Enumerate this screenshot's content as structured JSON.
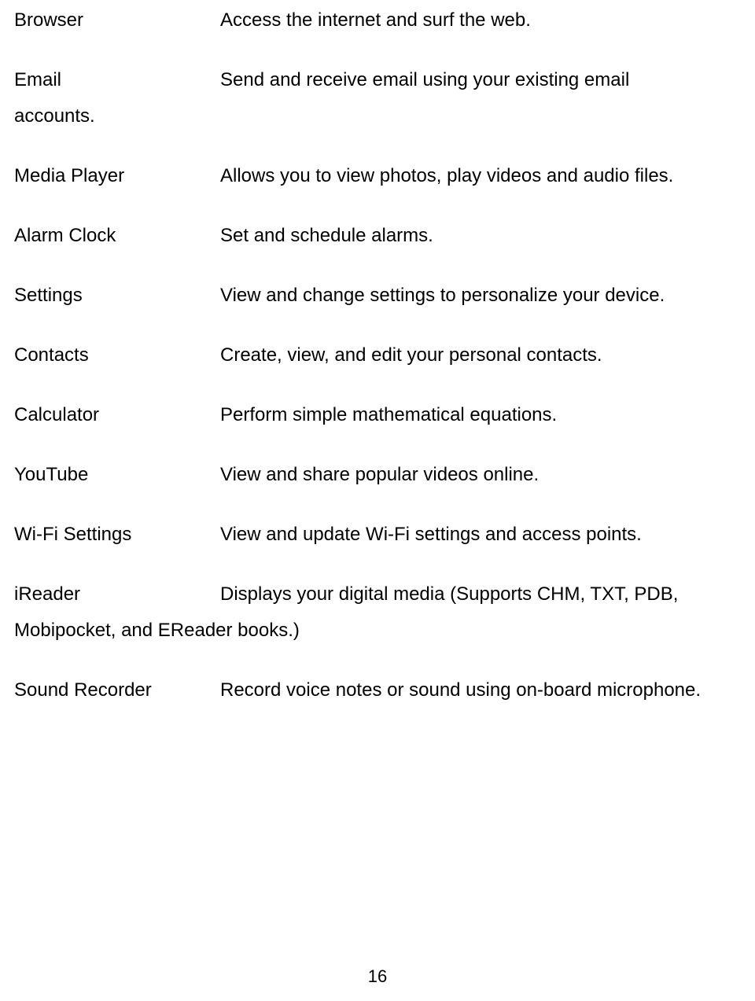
{
  "items": {
    "browser": {
      "label": "Browser",
      "desc": "Access the internet and surf the web."
    },
    "email": {
      "label": "Email",
      "desc": "Send and receive email using your existing email",
      "continued": "accounts."
    },
    "mediaPlayer": {
      "label": "Media Player",
      "desc": "Allows you to view photos, play videos and audio files."
    },
    "alarmClock": {
      "label": "Alarm Clock",
      "desc": "Set and schedule alarms."
    },
    "settings": {
      "label": "Settings",
      "desc": "View and change settings to personalize your device."
    },
    "contacts": {
      "label": "Contacts",
      "desc": "Create, view, and edit your personal contacts."
    },
    "calculator": {
      "label": "Calculator",
      "desc": "Perform simple mathematical equations."
    },
    "youtube": {
      "label": "YouTube",
      "desc": "View and share popular videos online."
    },
    "wifi": {
      "label": "Wi-Fi Settings",
      "desc": "View and update Wi-Fi settings and access points."
    },
    "ireader": {
      "label": "iReader",
      "desc": "Displays your digital media (Supports CHM, TXT, PDB,",
      "continued": "Mobipocket, and EReader books.)"
    },
    "soundRecorder": {
      "label": "Sound Recorder",
      "desc": "Record voice notes or sound using on-board microphone."
    }
  },
  "pageNumber": "16"
}
